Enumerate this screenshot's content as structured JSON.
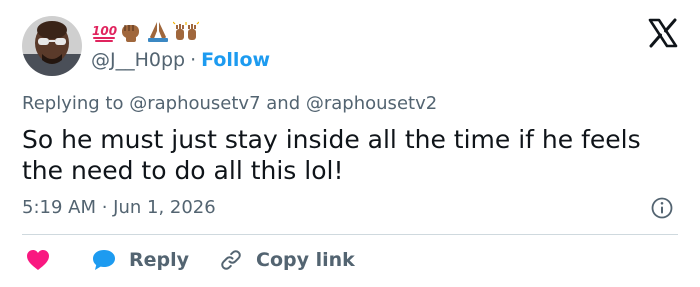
{
  "author": {
    "display_name_emojis": [
      "💯",
      "✊🏾",
      "🙏🏾",
      "🙌🏾"
    ],
    "handle": "@J__H0pp",
    "separator": "·",
    "follow_label": "Follow"
  },
  "reply_context": {
    "prefix": "Replying to",
    "mention_1": "@raphousetv7",
    "conjunction": "and",
    "mention_2": "@raphousetv2"
  },
  "tweet": {
    "text": "So he must just stay inside all the time if he feels the need to do all this lol!",
    "timestamp": "5:19 AM · Jun 1, 2026"
  },
  "actions": {
    "reply_label": "Reply",
    "copy_link_label": "Copy link"
  },
  "icons": {
    "brand": "x-logo-icon",
    "info": "info-icon",
    "like": "heart-icon",
    "reply": "speech-bubble-icon",
    "copy": "link-icon"
  },
  "colors": {
    "accent": "#1d9bf0",
    "like": "#f91880",
    "text_primary": "#0f1419",
    "text_secondary": "#536471",
    "divider": "#cfd9de"
  }
}
